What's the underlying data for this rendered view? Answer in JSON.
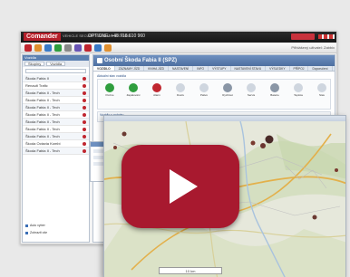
{
  "app": {
    "logo_part1": "Co",
    "logo_part2": "mander",
    "logo_tagline": "VEHICLE SECURITY AND MONITORING",
    "phone": "OPTIONE: +48 718 610 960",
    "user_info": "Přihlášený uživatel: Zabbix"
  },
  "left_panel": {
    "title": "Vozidla",
    "tabs": [
      "Skupiny",
      "Vozidla"
    ],
    "vehicles": [
      "Škoda Fabia II",
      "Renault Trafic",
      "Škoda Fabia II - Tech",
      "Škoda Fabia II - Tech",
      "Škoda Fabia II - Tech",
      "Škoda Fabia II - Tech",
      "Škoda Fabia II - Tech",
      "Škoda Fabia II - Tech",
      "Škoda Fabia II - Tech",
      "Škoda Octavia Kombi",
      "Škoda Fabia II - Tech"
    ],
    "footer_checks": [
      "Auto vyber",
      "Zobrazit vše"
    ]
  },
  "main": {
    "title": "Osobní Škoda Fabia II (SPZ)",
    "tabs": [
      "VOZIDLO",
      "ZÁZNAMY JÍZD",
      "KNIHA JÍZD",
      "NASTAVENÍ",
      "INFO",
      "VÝSTUPY",
      "NASTAVENÍ STAVU",
      "VÝSLEDKY",
      "PŘÍPOJ",
      "Doporučení"
    ],
    "section_title": "Aktuální stav vozidla",
    "sub_section_title": "Vozidlo v pohybu",
    "grid_items": [
      {
        "label": "Pozice",
        "color": "#2f9e3e"
      },
      {
        "label": "Zapalování",
        "color": "#2f9e3e"
      },
      {
        "label": "Alarm",
        "color": "#c0262f"
      },
      {
        "label": "Dveře",
        "color": "#cfd6df"
      },
      {
        "label": "Palivo",
        "color": "#cfd6df"
      },
      {
        "label": "Rychlost",
        "color": "#8a96a6"
      },
      {
        "label": "Servis",
        "color": "#cfd6df"
      },
      {
        "label": "Baterie",
        "color": "#8a96a6"
      },
      {
        "label": "Teplota",
        "color": "#cfd6df"
      },
      {
        "label": "Stav",
        "color": "#cfd6df"
      }
    ]
  },
  "map": {
    "scale_label": "10 km"
  },
  "video": {
    "play_color": "#a8192f",
    "play_icon": "play-triangle-icon"
  }
}
